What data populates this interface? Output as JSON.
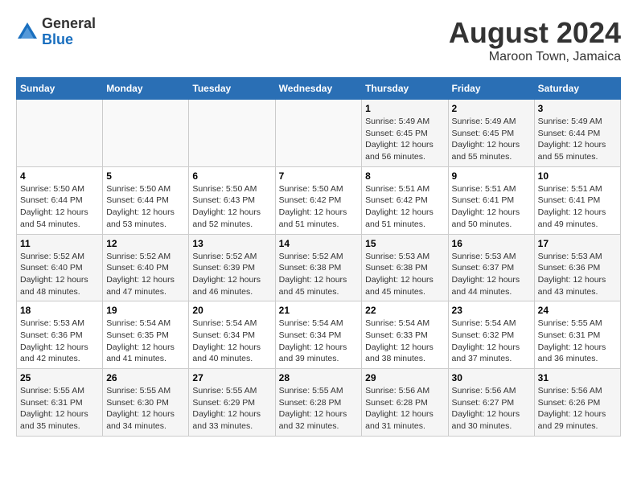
{
  "header": {
    "logo_general": "General",
    "logo_blue": "Blue",
    "month_year": "August 2024",
    "location": "Maroon Town, Jamaica"
  },
  "calendar": {
    "days_of_week": [
      "Sunday",
      "Monday",
      "Tuesday",
      "Wednesday",
      "Thursday",
      "Friday",
      "Saturday"
    ],
    "weeks": [
      [
        {
          "day": "",
          "info": ""
        },
        {
          "day": "",
          "info": ""
        },
        {
          "day": "",
          "info": ""
        },
        {
          "day": "",
          "info": ""
        },
        {
          "day": "1",
          "info": "Sunrise: 5:49 AM\nSunset: 6:45 PM\nDaylight: 12 hours\nand 56 minutes."
        },
        {
          "day": "2",
          "info": "Sunrise: 5:49 AM\nSunset: 6:45 PM\nDaylight: 12 hours\nand 55 minutes."
        },
        {
          "day": "3",
          "info": "Sunrise: 5:49 AM\nSunset: 6:44 PM\nDaylight: 12 hours\nand 55 minutes."
        }
      ],
      [
        {
          "day": "4",
          "info": "Sunrise: 5:50 AM\nSunset: 6:44 PM\nDaylight: 12 hours\nand 54 minutes."
        },
        {
          "day": "5",
          "info": "Sunrise: 5:50 AM\nSunset: 6:44 PM\nDaylight: 12 hours\nand 53 minutes."
        },
        {
          "day": "6",
          "info": "Sunrise: 5:50 AM\nSunset: 6:43 PM\nDaylight: 12 hours\nand 52 minutes."
        },
        {
          "day": "7",
          "info": "Sunrise: 5:50 AM\nSunset: 6:42 PM\nDaylight: 12 hours\nand 51 minutes."
        },
        {
          "day": "8",
          "info": "Sunrise: 5:51 AM\nSunset: 6:42 PM\nDaylight: 12 hours\nand 51 minutes."
        },
        {
          "day": "9",
          "info": "Sunrise: 5:51 AM\nSunset: 6:41 PM\nDaylight: 12 hours\nand 50 minutes."
        },
        {
          "day": "10",
          "info": "Sunrise: 5:51 AM\nSunset: 6:41 PM\nDaylight: 12 hours\nand 49 minutes."
        }
      ],
      [
        {
          "day": "11",
          "info": "Sunrise: 5:52 AM\nSunset: 6:40 PM\nDaylight: 12 hours\nand 48 minutes."
        },
        {
          "day": "12",
          "info": "Sunrise: 5:52 AM\nSunset: 6:40 PM\nDaylight: 12 hours\nand 47 minutes."
        },
        {
          "day": "13",
          "info": "Sunrise: 5:52 AM\nSunset: 6:39 PM\nDaylight: 12 hours\nand 46 minutes."
        },
        {
          "day": "14",
          "info": "Sunrise: 5:52 AM\nSunset: 6:38 PM\nDaylight: 12 hours\nand 45 minutes."
        },
        {
          "day": "15",
          "info": "Sunrise: 5:53 AM\nSunset: 6:38 PM\nDaylight: 12 hours\nand 45 minutes."
        },
        {
          "day": "16",
          "info": "Sunrise: 5:53 AM\nSunset: 6:37 PM\nDaylight: 12 hours\nand 44 minutes."
        },
        {
          "day": "17",
          "info": "Sunrise: 5:53 AM\nSunset: 6:36 PM\nDaylight: 12 hours\nand 43 minutes."
        }
      ],
      [
        {
          "day": "18",
          "info": "Sunrise: 5:53 AM\nSunset: 6:36 PM\nDaylight: 12 hours\nand 42 minutes."
        },
        {
          "day": "19",
          "info": "Sunrise: 5:54 AM\nSunset: 6:35 PM\nDaylight: 12 hours\nand 41 minutes."
        },
        {
          "day": "20",
          "info": "Sunrise: 5:54 AM\nSunset: 6:34 PM\nDaylight: 12 hours\nand 40 minutes."
        },
        {
          "day": "21",
          "info": "Sunrise: 5:54 AM\nSunset: 6:34 PM\nDaylight: 12 hours\nand 39 minutes."
        },
        {
          "day": "22",
          "info": "Sunrise: 5:54 AM\nSunset: 6:33 PM\nDaylight: 12 hours\nand 38 minutes."
        },
        {
          "day": "23",
          "info": "Sunrise: 5:54 AM\nSunset: 6:32 PM\nDaylight: 12 hours\nand 37 minutes."
        },
        {
          "day": "24",
          "info": "Sunrise: 5:55 AM\nSunset: 6:31 PM\nDaylight: 12 hours\nand 36 minutes."
        }
      ],
      [
        {
          "day": "25",
          "info": "Sunrise: 5:55 AM\nSunset: 6:31 PM\nDaylight: 12 hours\nand 35 minutes."
        },
        {
          "day": "26",
          "info": "Sunrise: 5:55 AM\nSunset: 6:30 PM\nDaylight: 12 hours\nand 34 minutes."
        },
        {
          "day": "27",
          "info": "Sunrise: 5:55 AM\nSunset: 6:29 PM\nDaylight: 12 hours\nand 33 minutes."
        },
        {
          "day": "28",
          "info": "Sunrise: 5:55 AM\nSunset: 6:28 PM\nDaylight: 12 hours\nand 32 minutes."
        },
        {
          "day": "29",
          "info": "Sunrise: 5:56 AM\nSunset: 6:28 PM\nDaylight: 12 hours\nand 31 minutes."
        },
        {
          "day": "30",
          "info": "Sunrise: 5:56 AM\nSunset: 6:27 PM\nDaylight: 12 hours\nand 30 minutes."
        },
        {
          "day": "31",
          "info": "Sunrise: 5:56 AM\nSunset: 6:26 PM\nDaylight: 12 hours\nand 29 minutes."
        }
      ]
    ]
  }
}
